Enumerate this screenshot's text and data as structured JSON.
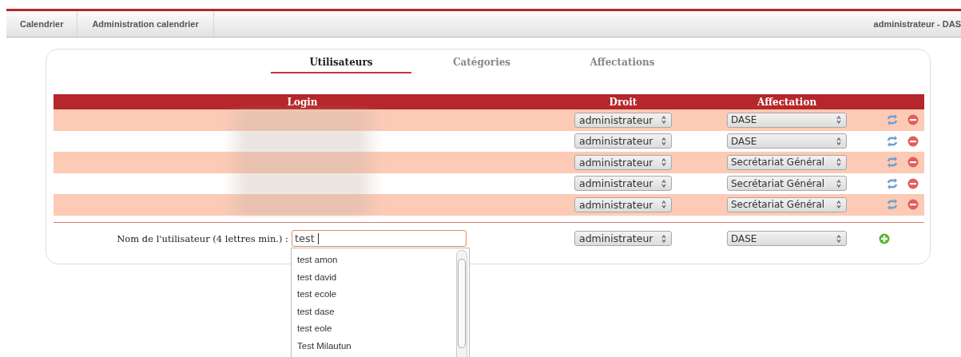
{
  "nav": {
    "items": [
      {
        "label": "Calendrier",
        "selected": false
      },
      {
        "label": "Administration calendrier",
        "selected": false
      }
    ],
    "user": "administrateur - DAS"
  },
  "tabs": [
    {
      "label": "Utilisateurs",
      "selected": true
    },
    {
      "label": "Catégories",
      "selected": false
    },
    {
      "label": "Affectations",
      "selected": false
    }
  ],
  "table": {
    "columns": [
      "Login",
      "Droit",
      "Affectation"
    ],
    "rows": [
      {
        "droit": "administrateur",
        "affectation": "DASE"
      },
      {
        "droit": "administrateur",
        "affectation": "DASE"
      },
      {
        "droit": "administrateur",
        "affectation": "Secrétariat Général"
      },
      {
        "droit": "administrateur",
        "affectation": "Secrétariat Général"
      },
      {
        "droit": "administrateur",
        "affectation": "Secrétariat Général"
      }
    ]
  },
  "add_row": {
    "label": "Nom de l'utilisateur (4 lettres min.) :",
    "value": "test",
    "droit": "administrateur",
    "affectation": "DASE",
    "suggestions": [
      "test amon",
      "test david",
      "test ecole",
      "test dase",
      "test eole",
      "Test Milautun"
    ]
  }
}
